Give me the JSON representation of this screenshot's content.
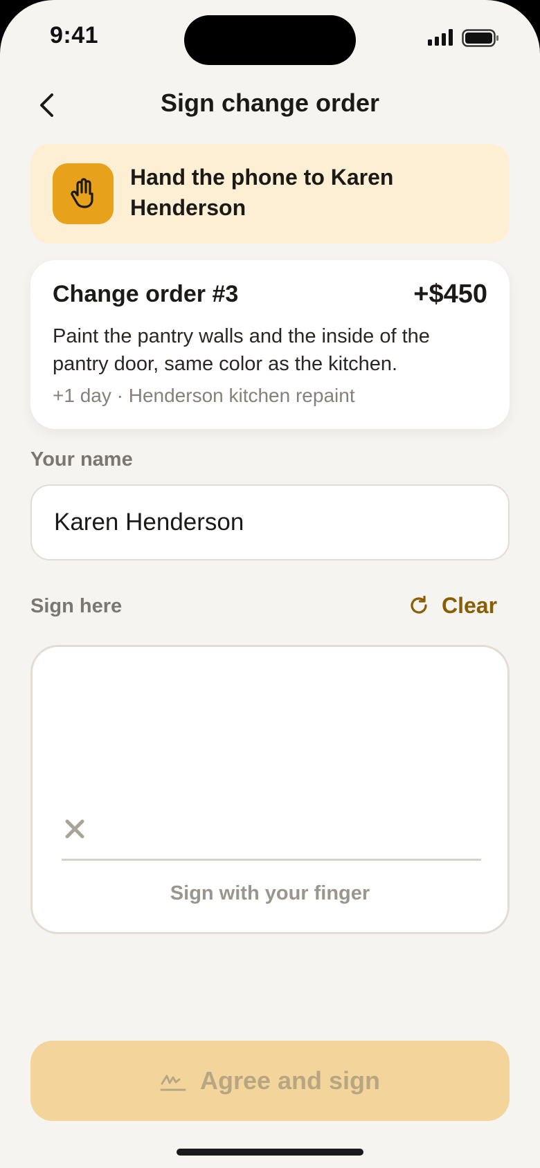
{
  "status_bar": {
    "time": "9:41"
  },
  "nav": {
    "title": "Sign change order",
    "back_icon": "chevron-left-icon"
  },
  "handoff": {
    "icon": "hand-icon",
    "text": "Hand the phone to Karen Henderson",
    "color": "#e8a11b"
  },
  "order": {
    "title": "Change order #3",
    "amount": "+$450",
    "description": "Paint the pantry walls and the inside of the pantry door, same color as the kitchen.",
    "meta": "+1 day · Henderson kitchen repaint"
  },
  "name_field": {
    "label": "Your name",
    "value": "Karen Henderson"
  },
  "signature": {
    "label": "Sign here",
    "clear_label": "Clear",
    "clear_icon": "refresh-icon",
    "hint": "Sign with your finger",
    "mark_icon": "x-icon"
  },
  "agree_button": {
    "label": "Agree and sign",
    "icon": "signature-icon",
    "state": "disabled"
  },
  "colors": {
    "background": "#f6f4f0",
    "accent": "#e8a11b",
    "accent_text": "#8a5d00",
    "banner_bg": "#fcefd3",
    "button_bg_disabled": "#f3d59b"
  }
}
